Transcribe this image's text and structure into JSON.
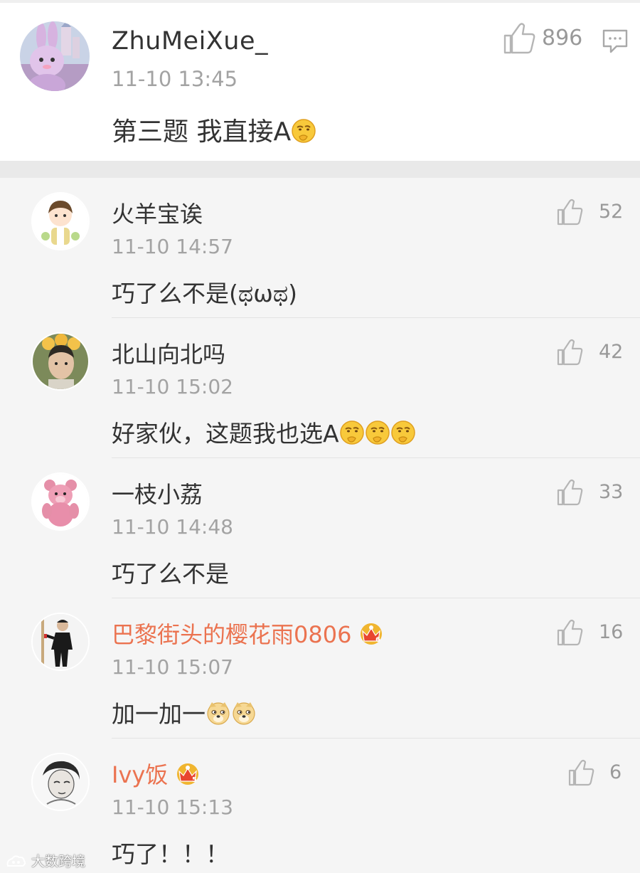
{
  "main_comment": {
    "username": "ZhuMeiXue_",
    "time": "11-10 13:45",
    "text": "第三题 我直接A",
    "likes": "896",
    "avatar_icon": "bunny-avatar-icon",
    "emoji": "thinking-face-emoji"
  },
  "replies": [
    {
      "username": "火羊宝诶",
      "time": "11-10 14:57",
      "text": "巧了么不是(ಥωಥ)",
      "likes": "52",
      "vip": false
    },
    {
      "username": "北山向北吗",
      "time": "11-10 15:02",
      "text": "好家伙，这题我也选A",
      "likes": "42",
      "vip": false
    },
    {
      "username": "一枝小荔",
      "time": "11-10 14:48",
      "text": "巧了么不是",
      "likes": "33",
      "vip": false
    },
    {
      "username": "巴黎街头的樱花雨0806",
      "time": "11-10 15:07",
      "text": "加一加一",
      "likes": "16",
      "vip": true
    },
    {
      "username": "Ivy饭",
      "time": "11-10 15:13",
      "text": "巧了！！！",
      "likes": "6",
      "vip": true
    }
  ],
  "watermark": "大数跨境",
  "colors": {
    "vip_name": "#eb7350",
    "text": "#333333",
    "meta": "#a3a3a3",
    "background": "#f5f5f5"
  }
}
